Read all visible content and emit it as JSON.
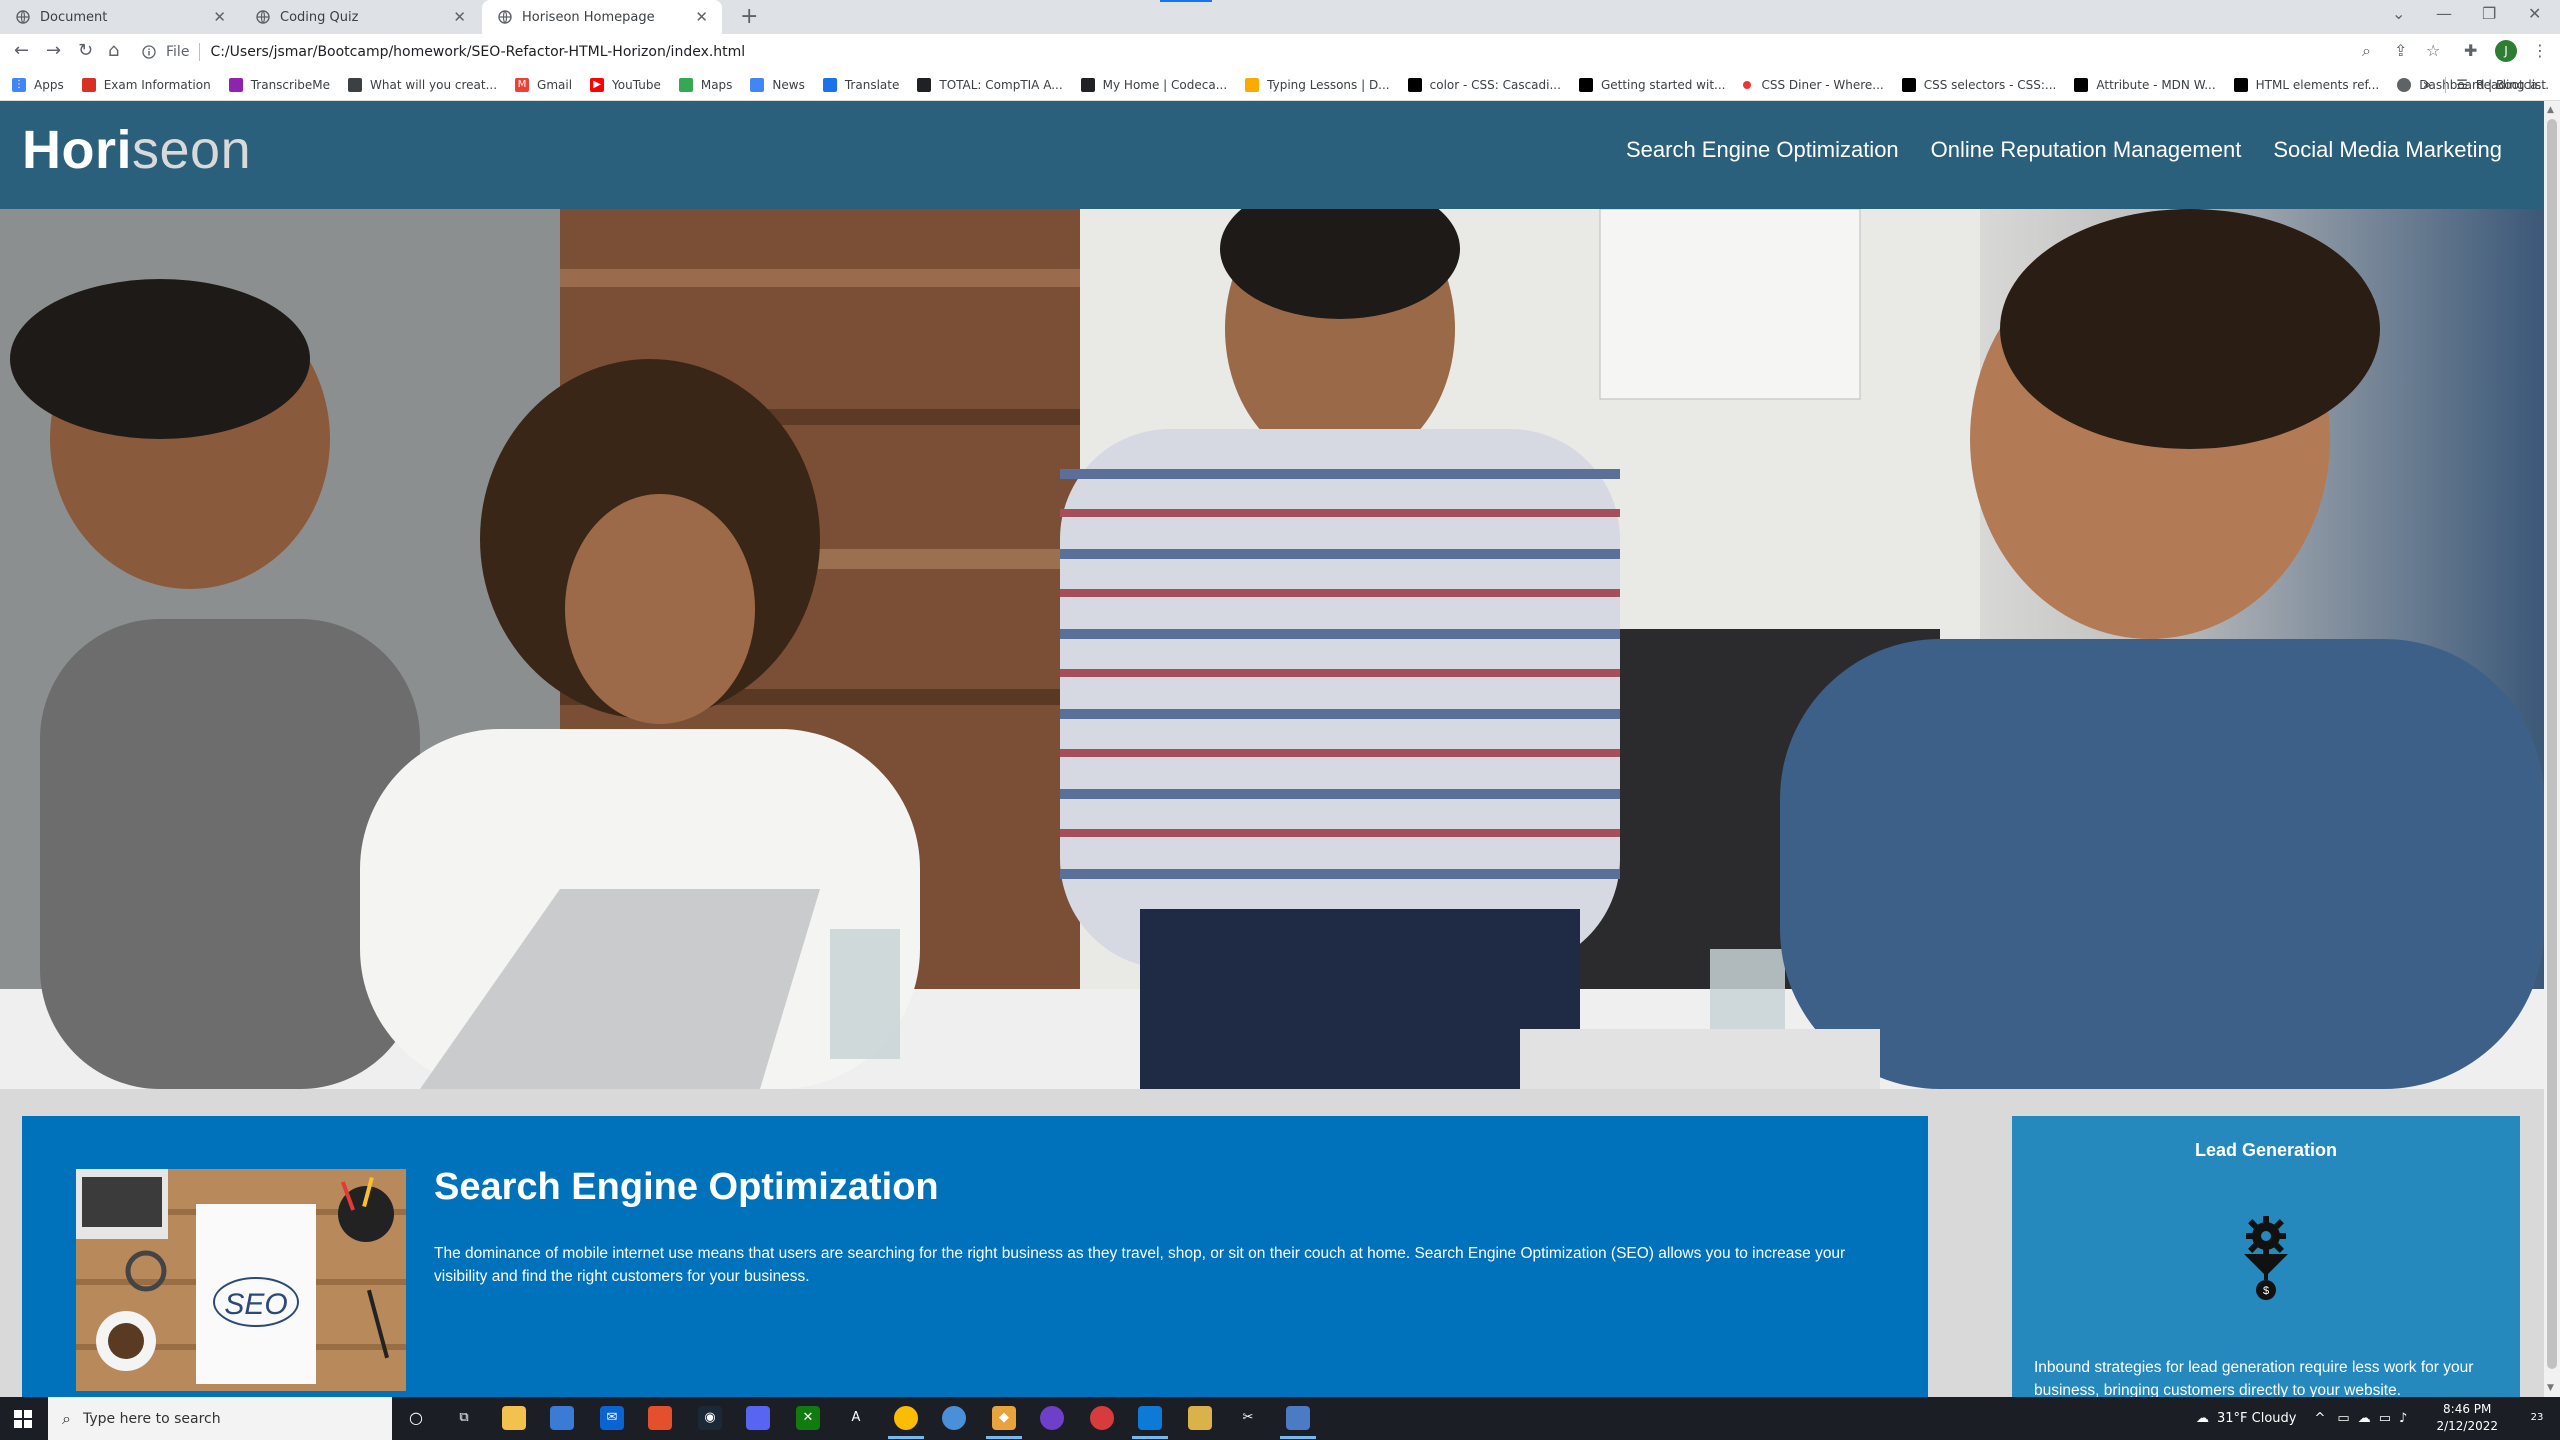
{
  "browser": {
    "tabs": [
      {
        "title": "Document",
        "active": false
      },
      {
        "title": "Coding Quiz",
        "active": false
      },
      {
        "title": "Horiseon Homepage",
        "active": true
      }
    ],
    "address": {
      "scheme_label": "File",
      "url": "C:/Users/jsmar/Bootcamp/homework/SEO-Refactor-HTML-Horizon/index.html"
    },
    "profile_initial": "J",
    "bookmarks": [
      {
        "label": "Apps",
        "icon": "apps-grid-icon",
        "color": "#4285f4"
      },
      {
        "label": "Exam Information",
        "icon": "exam-icon",
        "color": "#d93025"
      },
      {
        "label": "TranscribeMe",
        "icon": "transcribeme-icon",
        "color": "#8e24aa"
      },
      {
        "label": "What will you creat...",
        "icon": "grid-icon",
        "color": "#3c4043"
      },
      {
        "label": "Gmail",
        "icon": "gmail-icon",
        "color": "#ea4335"
      },
      {
        "label": "YouTube",
        "icon": "youtube-icon",
        "color": "#ff0000"
      },
      {
        "label": "Maps",
        "icon": "maps-icon",
        "color": "#34a853"
      },
      {
        "label": "News",
        "icon": "news-icon",
        "color": "#4285f4"
      },
      {
        "label": "Translate",
        "icon": "translate-icon",
        "color": "#1a73e8"
      },
      {
        "label": "TOTAL: CompTIA A...",
        "icon": "total-icon",
        "color": "#202124"
      },
      {
        "label": "My Home | Codeca...",
        "icon": "codecademy-icon",
        "color": "#202124"
      },
      {
        "label": "Typing Lessons | D...",
        "icon": "typing-icon",
        "color": "#f9ab00"
      },
      {
        "label": "color - CSS: Cascadi...",
        "icon": "mdn-icon",
        "color": "#000000"
      },
      {
        "label": "Getting started wit...",
        "icon": "mdn-icon",
        "color": "#000000"
      },
      {
        "label": "CSS Diner - Where...",
        "icon": "css-diner-icon",
        "color": "#e53935"
      },
      {
        "label": "CSS selectors - CSS:...",
        "icon": "mdn-icon",
        "color": "#000000"
      },
      {
        "label": "Attribute - MDN W...",
        "icon": "mdn-icon",
        "color": "#000000"
      },
      {
        "label": "HTML elements ref...",
        "icon": "mdn-icon",
        "color": "#000000"
      },
      {
        "label": "Dashboard | Bootca...",
        "icon": "globe-icon",
        "color": "#5f6368"
      }
    ],
    "reading_list_label": "Reading list"
  },
  "site": {
    "logo_main": "Hori",
    "logo_accent": "seon",
    "nav": [
      "Search Engine Optimization",
      "Online Reputation Management",
      "Social Media Marketing"
    ],
    "seo": {
      "title": "Search Engine Optimization",
      "text": "The dominance of mobile internet use means that users are searching for the right business as they travel, shop, or sit on their couch at home. Search Engine Optimization (SEO) allows you to increase your visibility and find the right customers for your business.",
      "image_word": "SEO"
    },
    "lead": {
      "title": "Lead Generation",
      "text": "Inbound strategies for lead generation require less work for your business, bringing customers directly to your website."
    },
    "colors": {
      "header": "#2a607c",
      "content_card": "#0072bb",
      "benefit_card": "#2589bd",
      "page_bg": "#d9d9d9"
    }
  },
  "taskbar": {
    "search_placeholder": "Type here to search",
    "weather": "31°F  Cloudy",
    "time": "8:46 PM",
    "date": "2/12/2022",
    "notifications": "23"
  }
}
